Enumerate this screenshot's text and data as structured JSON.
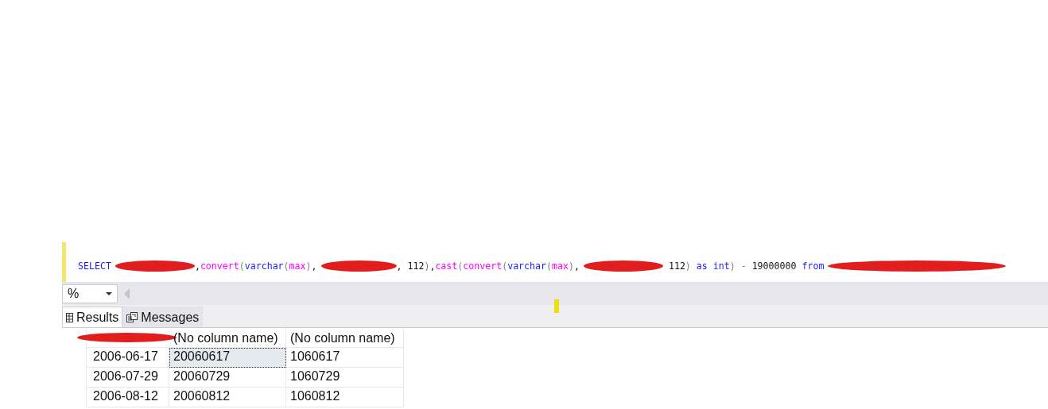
{
  "editor": {
    "tokens": [
      {
        "kind": "keyword",
        "text": "SELECT"
      },
      {
        "kind": "redacted"
      },
      {
        "kind": "plain",
        "text": ","
      },
      {
        "kind": "function",
        "text": "convert"
      },
      {
        "kind": "paren",
        "text": "("
      },
      {
        "kind": "keyword",
        "text": "varchar"
      },
      {
        "kind": "paren",
        "text": "("
      },
      {
        "kind": "function",
        "text": "max"
      },
      {
        "kind": "paren",
        "text": ")"
      },
      {
        "kind": "plain",
        "text": ","
      },
      {
        "kind": "redacted"
      },
      {
        "kind": "plain",
        "text": ", 112"
      },
      {
        "kind": "paren",
        "text": ")"
      },
      {
        "kind": "plain",
        "text": ","
      },
      {
        "kind": "function",
        "text": "cast"
      },
      {
        "kind": "paren",
        "text": "("
      },
      {
        "kind": "function",
        "text": "convert"
      },
      {
        "kind": "paren",
        "text": "("
      },
      {
        "kind": "keyword",
        "text": "varchar"
      },
      {
        "kind": "paren",
        "text": "("
      },
      {
        "kind": "function",
        "text": "max"
      },
      {
        "kind": "paren",
        "text": ")"
      },
      {
        "kind": "plain",
        "text": ","
      },
      {
        "kind": "redacted"
      },
      {
        "kind": "plain",
        "text": " 112"
      },
      {
        "kind": "paren",
        "text": ")"
      },
      {
        "kind": "keyword",
        "text": " as int"
      },
      {
        "kind": "paren",
        "text": ") - "
      },
      {
        "kind": "plain",
        "text": "19000000"
      },
      {
        "kind": "keyword",
        "text": " from"
      },
      {
        "kind": "redacted"
      }
    ]
  },
  "zoom": {
    "value": "%"
  },
  "tabs": [
    {
      "label": "Results",
      "selected": true
    },
    {
      "label": "Messages",
      "selected": false
    }
  ],
  "table": {
    "columns": [
      {
        "kind": "redacted"
      },
      {
        "kind": "text",
        "label": "(No column name)"
      },
      {
        "kind": "text",
        "label": "(No column name)"
      }
    ],
    "rows": [
      {
        "cells": [
          {
            "text": "2006-06-17",
            "selected": false
          },
          {
            "text": "20060617",
            "selected": true
          },
          {
            "text": "1060617",
            "selected": false
          }
        ]
      },
      {
        "cells": [
          {
            "text": "2006-07-29",
            "selected": false
          },
          {
            "text": "20060729",
            "selected": false
          },
          {
            "text": "1060729",
            "selected": false
          }
        ]
      },
      {
        "cells": [
          {
            "text": "2006-08-12",
            "selected": false
          },
          {
            "text": "20060812",
            "selected": false
          },
          {
            "text": "1060812",
            "selected": false
          }
        ]
      }
    ]
  }
}
